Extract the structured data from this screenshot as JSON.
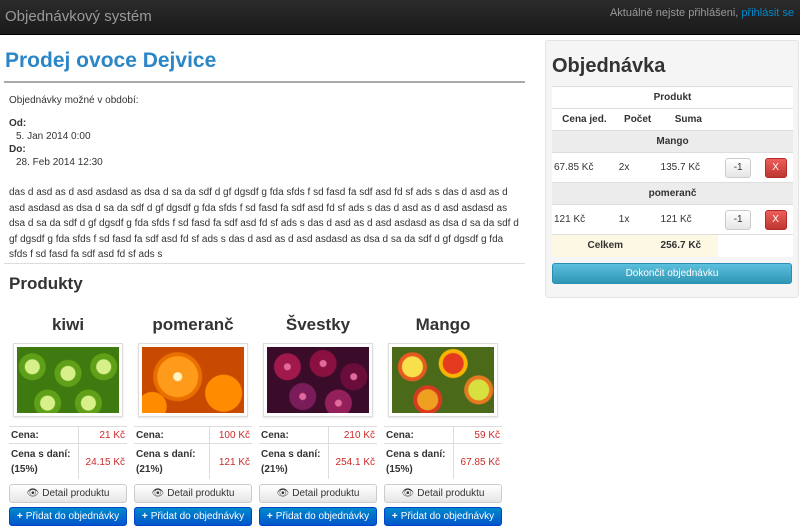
{
  "navbar": {
    "brand": "Objednávkový systém",
    "login_text": "Aktuálně nejste přihlášeni,",
    "login_link": "přihlásit se"
  },
  "page": {
    "title": "Prodej ovoce Dejvice",
    "period_label": "Objednávky možné v období:",
    "from_label": "Od:",
    "from_value": "5. Jan 2014 0:00",
    "to_label": "Do:",
    "to_value": "28. Feb 2014 12:30",
    "description": "das d asd as d asd asdasd as dsa d sa da sdf d gf dgsdf g fda sfds f sd fasd fa sdf asd fd sf ads s das d asd as d asd asdasd as dsa d sa da sdf d gf dgsdf g fda sfds f sd fasd fa sdf asd fd sf ads s das d asd as d asd asdasd as dsa d sa da sdf d gf dgsdf g fda sfds f sd fasd fa sdf asd fd sf ads s das d asd as d asd asdasd as dsa d sa da sdf d gf dgsdf g fda sfds f sd fasd fa sdf asd fd sf ads s das d asd as d asd asdasd as dsa d sa da sdf d gf dgsdf g fda sfds f sd fasd fa sdf asd fd sf ads s",
    "products_heading": "Produkty"
  },
  "labels": {
    "price": "Cena:",
    "price_tax": "Cena s daní:",
    "detail_button": "Detail produktu",
    "add_button": "Přidat do objednávky"
  },
  "products": [
    {
      "name": "kiwi",
      "price": "21 Kč",
      "tax": "(15%)",
      "price_tax": "24.15 Kč",
      "image": "kiwi-photo"
    },
    {
      "name": "pomeranč",
      "price": "100 Kč",
      "tax": "(21%)",
      "price_tax": "121 Kč",
      "image": "orange-photo"
    },
    {
      "name": "Švestky",
      "price": "210 Kč",
      "tax": "(21%)",
      "price_tax": "254.1 Kč",
      "image": "plum-photo"
    },
    {
      "name": "Mango",
      "price": "59 Kč",
      "tax": "(15%)",
      "price_tax": "67.85 Kč",
      "image": "mango-photo"
    }
  ],
  "order": {
    "title": "Objednávka",
    "header": {
      "product": "Produkt",
      "unit_price": "Cena jed.",
      "count": "Počet",
      "sum": "Suma"
    },
    "items": [
      {
        "name": "Mango",
        "unit_price": "67.85 Kč",
        "count": "2x",
        "sum": "135.7 Kč",
        "minus": "-1",
        "remove": "X"
      },
      {
        "name": "pomeranč",
        "unit_price": "121 Kč",
        "count": "1x",
        "sum": "121 Kč",
        "minus": "-1",
        "remove": "X"
      }
    ],
    "total_label": "Celkem",
    "total_value": "256.7 Kč",
    "finish_button": "Dokončit objednávku"
  },
  "colors": {
    "accent": "#2a86c7",
    "price_red": "#cc2a2a",
    "primary_button": "#0066cc",
    "danger": "#da4f49",
    "info": "#49afcd"
  }
}
